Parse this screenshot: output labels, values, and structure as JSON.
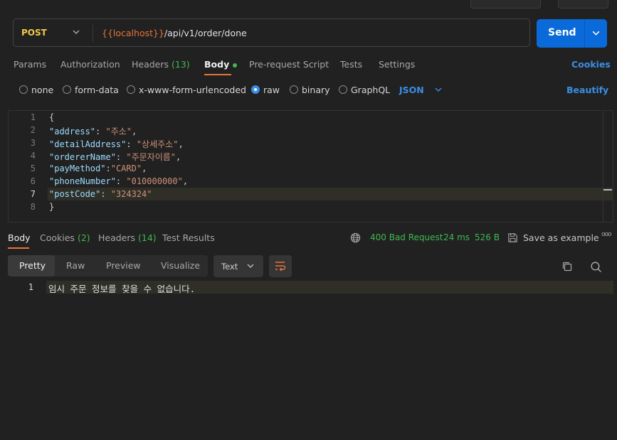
{
  "request": {
    "method": "POST",
    "url_variable": "{{localhost}}",
    "url_path": "/api/v1/order/done",
    "send_label": "Send"
  },
  "request_tabs": {
    "params": "Params",
    "authorization": "Authorization",
    "headers": "Headers",
    "headers_count": "(13)",
    "body": "Body",
    "prerequest": "Pre-request Script",
    "tests": "Tests",
    "settings": "Settings",
    "cookies_link": "Cookies"
  },
  "body_options": {
    "none": "none",
    "form_data": "form-data",
    "urlencoded": "x-www-form-urlencoded",
    "raw": "raw",
    "binary": "binary",
    "graphql": "GraphQL",
    "selected": "raw",
    "format": "JSON",
    "beautify": "Beautify"
  },
  "editor": {
    "current_line": 7,
    "lines": [
      {
        "num": "1",
        "pre": "{",
        "key": "",
        "sep": "",
        "val": "",
        "post": ""
      },
      {
        "num": "2",
        "pre": "",
        "key": "\"address\"",
        "sep": ": ",
        "val": "\"주소\"",
        "post": ","
      },
      {
        "num": "3",
        "pre": "",
        "key": "\"detailAddress\"",
        "sep": ": ",
        "val": "\"상세주소\"",
        "post": ","
      },
      {
        "num": "4",
        "pre": "",
        "key": "\"ordererName\"",
        "sep": ": ",
        "val": "\"주문자이름\"",
        "post": ","
      },
      {
        "num": "5",
        "pre": "",
        "key": "\"payMethod\"",
        "sep": ":",
        "val": "\"CARD\"",
        "post": ","
      },
      {
        "num": "6",
        "pre": "",
        "key": "\"phoneNumber\"",
        "sep": ": ",
        "val": "\"010000000\"",
        "post": ","
      },
      {
        "num": "7",
        "pre": "",
        "key": "\"postCode\"",
        "sep": ": ",
        "val": "\"324324\"",
        "post": ""
      },
      {
        "num": "8",
        "pre": "}",
        "key": "",
        "sep": "",
        "val": "",
        "post": ""
      }
    ]
  },
  "response_tabs": {
    "body": "Body",
    "cookies": "Cookies",
    "cookies_count": "(2)",
    "headers": "Headers",
    "headers_count": "(14)",
    "test_results": "Test Results"
  },
  "response_status": {
    "status": "400 Bad Request",
    "time": "24 ms",
    "size": "526 B",
    "save_label": "Save as example",
    "more": "ooo"
  },
  "response_view": {
    "pretty": "Pretty",
    "raw": "Raw",
    "preview": "Preview",
    "visualize": "Visualize",
    "format": "Text"
  },
  "response_body": {
    "line_num": "1",
    "text": "임시 주문 정보를 찾을 수 없습니다."
  },
  "colors": {
    "accent_orange": "#e8743b",
    "send_blue": "#0b6ad9",
    "link_blue": "#3a8ee6",
    "status_green": "#3fb950",
    "method_yellow": "#f2c94c"
  }
}
